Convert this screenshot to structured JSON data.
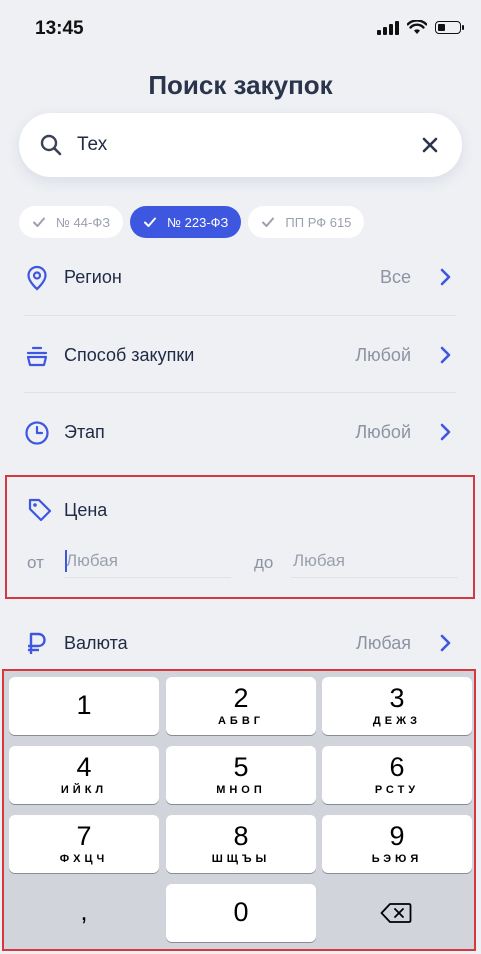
{
  "status_bar": {
    "time": "13:45"
  },
  "page": {
    "title": "Поиск закупок"
  },
  "search": {
    "value": "Тех",
    "placeholder": ""
  },
  "chips": [
    {
      "label": "№ 44-ФЗ",
      "selected": false
    },
    {
      "label": "№ 223-ФЗ",
      "selected": true
    },
    {
      "label": "ПП РФ 615",
      "selected": false
    }
  ],
  "filters": {
    "region": {
      "label": "Регион",
      "value": "Все",
      "icon": "location-pin-icon"
    },
    "method": {
      "label": "Способ закупки",
      "value": "Любой",
      "icon": "bowl-stack-icon"
    },
    "stage": {
      "label": "Этап",
      "value": "Любой",
      "icon": "clock-icon"
    },
    "currency": {
      "label": "Валюта",
      "value": "Любая",
      "icon": "ruble-icon"
    }
  },
  "price": {
    "label": "Цена",
    "icon": "price-tag-icon",
    "from_label": "от",
    "from_placeholder": "Любая",
    "to_label": "до",
    "to_placeholder": "Любая"
  },
  "keypad": {
    "keys": [
      {
        "digit": "1",
        "letters": ""
      },
      {
        "digit": "2",
        "letters": "АБВГ"
      },
      {
        "digit": "3",
        "letters": "ДЕЖЗ"
      },
      {
        "digit": "4",
        "letters": "ИЙКЛ"
      },
      {
        "digit": "5",
        "letters": "МНОП"
      },
      {
        "digit": "6",
        "letters": "РСТУ"
      },
      {
        "digit": "7",
        "letters": "ФХЦЧ"
      },
      {
        "digit": "8",
        "letters": "ШЩЪЫ"
      },
      {
        "digit": "9",
        "letters": "ЬЭЮЯ"
      }
    ],
    "comma": ",",
    "zero": "0"
  },
  "colors": {
    "accent": "#3d57e0",
    "highlight": "#d7373f",
    "background": "#eef0f4"
  }
}
